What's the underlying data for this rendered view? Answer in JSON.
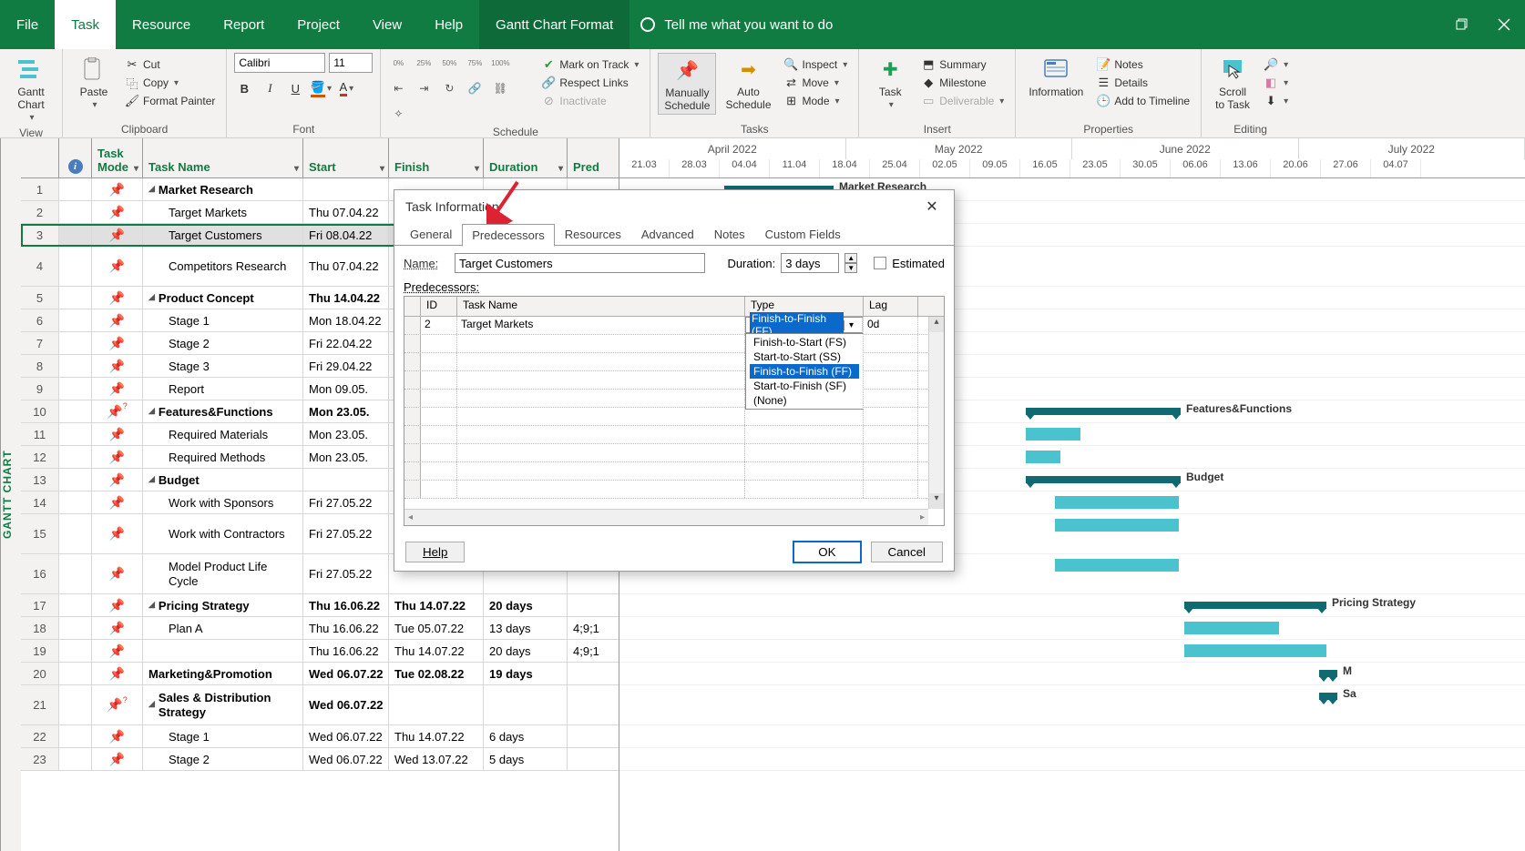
{
  "menu": {
    "file": "File",
    "task": "Task",
    "resource": "Resource",
    "report": "Report",
    "project": "Project",
    "view": "View",
    "help": "Help",
    "format": "Gantt Chart Format",
    "tellme": "Tell me what you want to do"
  },
  "ribbon": {
    "view_group": "View",
    "gantt_chart": "Gantt\nChart",
    "clipboard_group": "Clipboard",
    "paste": "Paste",
    "cut": "Cut",
    "copy": "Copy",
    "fmtpainter": "Format Painter",
    "font_group": "Font",
    "font_name": "Calibri",
    "font_size": "11",
    "schedule_group": "Schedule",
    "mark": "Mark on Track",
    "respect": "Respect Links",
    "inactivate": "Inactivate",
    "manual": "Manually\nSchedule",
    "auto": "Auto\nSchedule",
    "tasks_group": "Tasks",
    "inspect": "Inspect",
    "move": "Move",
    "mode": "Mode",
    "insert_group": "Insert",
    "task_btn": "Task",
    "summary": "Summary",
    "milestone": "Milestone",
    "deliverable": "Deliverable",
    "properties_group": "Properties",
    "information": "Information",
    "notes": "Notes",
    "details": "Details",
    "timeline": "Add to Timeline",
    "editing_group": "Editing",
    "scroll": "Scroll\nto Task"
  },
  "columns": {
    "mode": "Task\nMode",
    "task": "Task Name",
    "start": "Start",
    "finish": "Finish",
    "duration": "Duration",
    "pred": "Pred"
  },
  "sidelabel": "GANTT CHART",
  "timescale": {
    "months": [
      "April 2022",
      "May 2022",
      "June 2022",
      "July 2022"
    ],
    "dates": [
      "21.03",
      "28.03",
      "04.04",
      "11.04",
      "18.04",
      "25.04",
      "02.05",
      "09.05",
      "16.05",
      "23.05",
      "30.05",
      "06.06",
      "13.06",
      "20.06",
      "27.06",
      "04.07"
    ]
  },
  "rows": [
    {
      "n": "1",
      "mode": "pin",
      "task": "Market Research",
      "bold": true,
      "outline": true,
      "start": "",
      "finish": "",
      "dur": "",
      "pred": "",
      "summary": true,
      "bar": [
        115,
        120
      ],
      "label": "Market Research"
    },
    {
      "n": "2",
      "mode": "pin",
      "task": "Target Markets",
      "indent": 1,
      "start": "Thu 07.04.22",
      "finish": "",
      "dur": "",
      "pred": ""
    },
    {
      "n": "3",
      "mode": "pin",
      "task": "Target Customers",
      "indent": 1,
      "start": "Fri 08.04.22",
      "finish": "",
      "dur": "",
      "pred": "",
      "selected": true
    },
    {
      "n": "4",
      "mode": "pin",
      "task": "Competitors Research",
      "indent": 1,
      "tall": true,
      "start": "Thu 07.04.22",
      "finish": "",
      "dur": "",
      "pred": ""
    },
    {
      "n": "5",
      "mode": "pin",
      "task": "Product Concept",
      "bold": true,
      "outline": true,
      "start": "Thu 14.04.22",
      "finish": "",
      "dur": "",
      "pred": ""
    },
    {
      "n": "6",
      "mode": "pin",
      "task": "Stage 1",
      "indent": 1,
      "start": "Mon 18.04.22",
      "finish": "",
      "dur": "",
      "pred": ""
    },
    {
      "n": "7",
      "mode": "pin",
      "task": "Stage 2",
      "indent": 1,
      "start": "Fri 22.04.22",
      "finish": "",
      "dur": "",
      "pred": ""
    },
    {
      "n": "8",
      "mode": "pin",
      "task": "Stage 3",
      "indent": 1,
      "start": "Fri 29.04.22",
      "finish": "",
      "dur": "",
      "pred": ""
    },
    {
      "n": "9",
      "mode": "pin",
      "task": "Report",
      "indent": 1,
      "start": "Mon 09.05.",
      "finish": "",
      "dur": "",
      "pred": ""
    },
    {
      "n": "10",
      "mode": "pinq",
      "task": "Features&Functions",
      "bold": true,
      "outline": true,
      "start": "Mon 23.05.",
      "finish": "",
      "dur": "",
      "pred": "",
      "summary": true,
      "bar": [
        446,
        170
      ],
      "label": "Features&Functions"
    },
    {
      "n": "11",
      "mode": "pin",
      "task": "Required Materials",
      "indent": 1,
      "start": "Mon 23.05.",
      "finish": "",
      "dur": "",
      "pred": "",
      "bar": [
        446,
        60
      ]
    },
    {
      "n": "12",
      "mode": "pin",
      "task": "Required Methods",
      "indent": 1,
      "start": "Mon 23.05.",
      "finish": "",
      "dur": "",
      "pred": "",
      "bar": [
        446,
        38
      ]
    },
    {
      "n": "13",
      "mode": "pin",
      "task": "Budget",
      "bold": true,
      "outline": true,
      "start": "",
      "finish": "",
      "dur": "",
      "pred": "",
      "summary": true,
      "bar": [
        446,
        170
      ],
      "label": "Budget"
    },
    {
      "n": "14",
      "mode": "pin",
      "task": "Work with Sponsors",
      "indent": 1,
      "start": "Fri 27.05.22",
      "finish": "",
      "dur": "",
      "pred": "",
      "bar": [
        478,
        136
      ]
    },
    {
      "n": "15",
      "mode": "pin",
      "task": "Work with Contractors",
      "indent": 1,
      "tall": true,
      "start": "Fri 27.05.22",
      "finish": "",
      "dur": "",
      "pred": "",
      "bar": [
        478,
        136
      ]
    },
    {
      "n": "16",
      "mode": "pin",
      "task": "Model Product Life Cycle",
      "indent": 1,
      "tall": true,
      "start": "Fri 27.05.22",
      "finish": "",
      "dur": "",
      "pred": "",
      "bar": [
        478,
        136
      ]
    },
    {
      "n": "17",
      "mode": "pin",
      "task": "Pricing Strategy",
      "bold": true,
      "outline": true,
      "start": "Thu 16.06.22",
      "finish": "Thu 14.07.22",
      "dur": "20 days",
      "pred": "",
      "summary": true,
      "bar": [
        620,
        156
      ],
      "label": "Pricing Strategy"
    },
    {
      "n": "18",
      "mode": "pin",
      "task": "Plan A",
      "indent": 1,
      "start": "Thu 16.06.22",
      "finish": "Tue 05.07.22",
      "dur": "13 days",
      "pred": "4;9;1",
      "bar": [
        620,
        104
      ]
    },
    {
      "n": "19",
      "mode": "pin",
      "task": "",
      "indent": 1,
      "start": "Thu 16.06.22",
      "finish": "Thu 14.07.22",
      "dur": "20 days",
      "pred": "4;9;1",
      "bar": [
        620,
        156
      ]
    },
    {
      "n": "20",
      "mode": "pin",
      "task": "Marketing&Promotion",
      "bold": true,
      "start": "Wed 06.07.22",
      "finish": "Tue 02.08.22",
      "dur": "19 days",
      "pred": "",
      "summary": true,
      "bar": [
        768,
        20
      ],
      "label": "M"
    },
    {
      "n": "21",
      "mode": "pinq2",
      "task": "Sales & Distribution Strategy",
      "bold": true,
      "outline": true,
      "tall": true,
      "start": "Wed 06.07.22",
      "finish": "",
      "dur": "",
      "pred": "",
      "summary": true,
      "bar": [
        768,
        20
      ],
      "label": "Sa"
    },
    {
      "n": "22",
      "mode": "pin",
      "task": "Stage 1",
      "indent": 1,
      "start": "Wed 06.07.22",
      "finish": "Thu 14.07.22",
      "dur": "6 days",
      "pred": ""
    },
    {
      "n": "23",
      "mode": "pin",
      "task": "Stage 2",
      "indent": 1,
      "start": "Wed 06.07.22",
      "finish": "Wed 13.07.22",
      "dur": "5 days",
      "pred": ""
    }
  ],
  "dialog": {
    "title": "Task Information",
    "tabs": {
      "general": "General",
      "pred": "Predecessors",
      "res": "Resources",
      "adv": "Advanced",
      "notes": "Notes",
      "cf": "Custom Fields"
    },
    "name_lbl": "Name:",
    "name_val": "Target Customers",
    "dur_lbl": "Duration:",
    "dur_val": "3 days",
    "est_lbl": "Estimated",
    "pred_lbl": "Predecessors:",
    "cols": {
      "id": "ID",
      "tn": "Task Name",
      "type": "Type",
      "lag": "Lag"
    },
    "row1": {
      "id": "2",
      "tn": "Target Markets",
      "type": "Finish-to-Finish (FF)",
      "lag": "0d"
    },
    "options": [
      "Finish-to-Start (FS)",
      "Start-to-Start (SS)",
      "Finish-to-Finish (FF)",
      "Start-to-Finish (SF)",
      "(None)"
    ],
    "help": "Help",
    "ok": "OK",
    "cancel": "Cancel"
  }
}
